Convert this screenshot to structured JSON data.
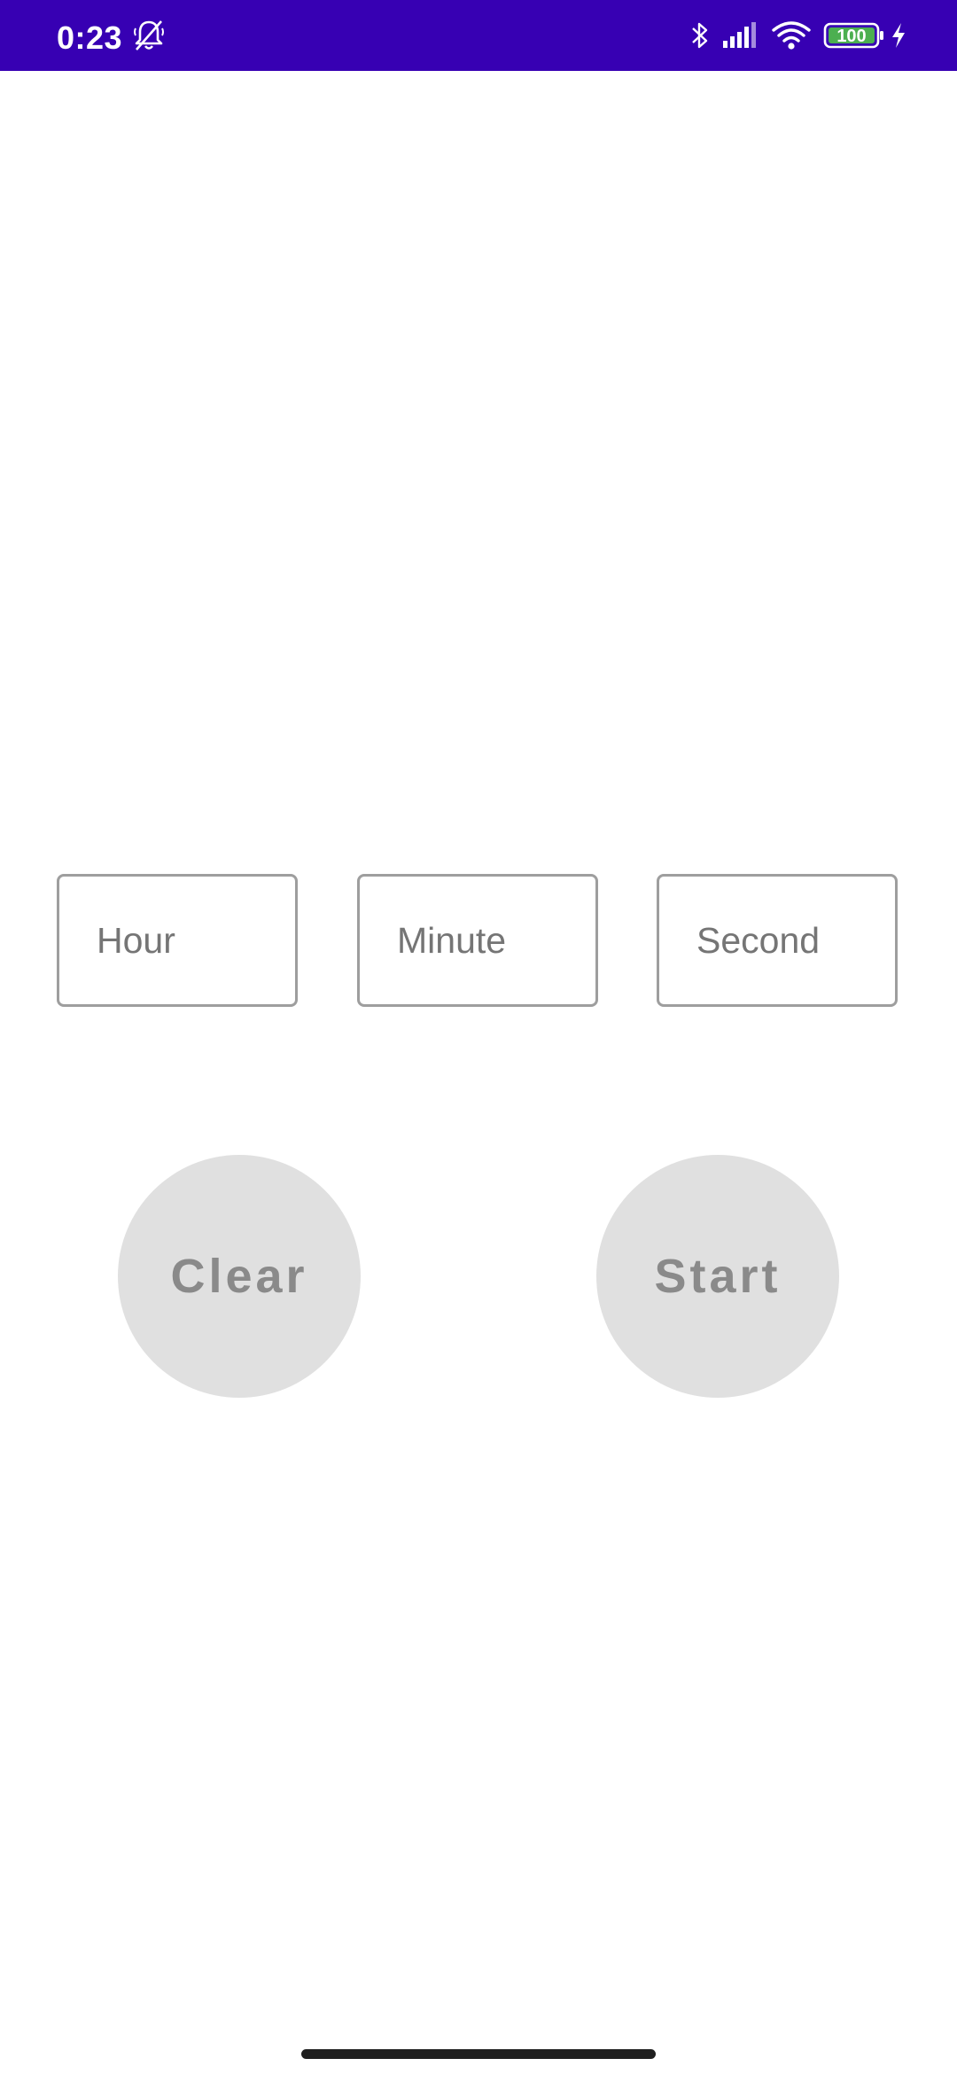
{
  "status_bar": {
    "time": "0:23",
    "battery_level": "100",
    "background_color": "#3700b3",
    "icons": [
      "bell-muted-icon",
      "bluetooth-icon",
      "cell-signal-icon",
      "wifi-icon",
      "battery-icon",
      "charging-bolt-icon"
    ]
  },
  "timer_inputs": {
    "hour_placeholder": "Hour",
    "minute_placeholder": "Minute",
    "second_placeholder": "Second",
    "hour_value": "",
    "minute_value": "",
    "second_value": ""
  },
  "buttons": {
    "clear_label": "Clear",
    "start_label": "Start",
    "button_color": "#e0e0e0"
  }
}
